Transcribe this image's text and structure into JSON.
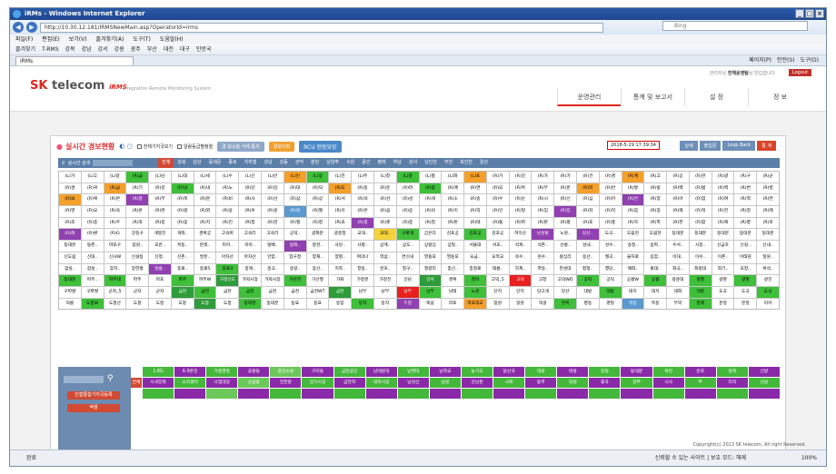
{
  "window": {
    "title": "iRMs - Windows Internet Explorer",
    "url": "http://10.30.12.181/IRMSNewMain.asp?OperatorId=irms",
    "search_placeholder": "Bing",
    "tab": "iRMs"
  },
  "menu": [
    "파일(F)",
    "편집(E)",
    "보기(V)",
    "즐겨찾기(A)",
    "도구(T)",
    "도움말(H)"
  ],
  "favorites": [
    "즐겨찾기",
    "T-RMS",
    "강북",
    "강남",
    "강서",
    "강원",
    "광주",
    "부산",
    "대전",
    "대구",
    "인방국"
  ],
  "ie_tools": [
    "페이지(P)",
    "안전(S)",
    "도구(O)"
  ],
  "site": {
    "logo_sk": "SK",
    "logo_tel": " telecom",
    "logo_irms": "iRMS",
    "tagline": "Integration Remote Monitoring System",
    "toplinks_prefix": "관리자님",
    "toplinks_admin": "전체운영팀",
    "toplinks_suffix": "님 반갑습니다",
    "logout": "Logout",
    "nav": [
      "운영관리",
      "통계 및 보고서",
      "설 정",
      "정 보"
    ]
  },
  "panel": {
    "title": "실시간 경보현황",
    "chk1": "전체기지국보기",
    "chk2": "일람등급별정렬",
    "pill1": "경 보소팅 삭제 통지",
    "pill2": "경보이력",
    "pill3": "RCU 현장요망",
    "timestamp": "2018-5-29 17:39:34",
    "btn_detail": "상세",
    "btn_out": "출입문",
    "btn_loop": "Loop Back",
    "btn_stats": "통 계",
    "search_label": "실시간 검색"
  },
  "regions": [
    "전체",
    "강북",
    "남산",
    "동대문",
    "종로",
    "지하철",
    "강남",
    "강동",
    "관악",
    "분당",
    "남양주",
    "수원",
    "용인",
    "평택",
    "하남",
    "강서",
    "남인천",
    "부천",
    "북인천",
    "일산"
  ],
  "grid_rows": [
    [
      [
        "(L)가",
        "w"
      ],
      [
        "(L)고",
        "w"
      ],
      [
        "(L)광",
        "w"
      ],
      [
        "(R)금",
        "g"
      ],
      [
        "(L)남",
        "w"
      ],
      [
        "(L)대",
        "w"
      ],
      [
        "(L)세",
        "w"
      ],
      [
        "(L)수",
        "w"
      ],
      [
        "(L)신",
        "w"
      ],
      [
        "(L)안",
        "w"
      ],
      [
        "(L)인",
        "o"
      ],
      [
        "(L)장",
        "g"
      ],
      [
        "(L)전",
        "w"
      ],
      [
        "(L)주",
        "w"
      ],
      [
        "(L)청",
        "w"
      ],
      [
        "(L)충",
        "g"
      ],
      [
        "(L)평",
        "w"
      ],
      [
        "(L)화",
        "w"
      ],
      [
        "(L)효",
        "o"
      ],
      [
        "(R)가",
        "w"
      ],
      [
        "(R)강",
        "w"
      ],
      [
        "(R)가",
        "w"
      ],
      [
        "(R)가",
        "w"
      ],
      [
        "(R)건",
        "w"
      ],
      [
        "(R)경",
        "w"
      ],
      [
        "(R)계",
        "o"
      ],
      [
        "(R)고",
        "w"
      ],
      [
        "(R)공",
        "w"
      ],
      [
        "(R)관",
        "w"
      ],
      [
        "(R)광",
        "w"
      ],
      [
        "(R)구",
        "w"
      ],
      [
        "(R)군",
        "w"
      ]
    ],
    [
      [
        "(R)권",
        "w"
      ],
      [
        "(R)귀",
        "w"
      ],
      [
        "(R)금",
        "o"
      ],
      [
        "(R)기",
        "w"
      ],
      [
        "(R)김",
        "w"
      ],
      [
        "(R)남",
        "g"
      ],
      [
        "(R)내",
        "w"
      ],
      [
        "(R)노",
        "w"
      ],
      [
        "(R)단",
        "w"
      ],
      [
        "(R)당",
        "w"
      ],
      [
        "(R)대",
        "w"
      ],
      [
        "(R)덕",
        "w"
      ],
      [
        "(R)도",
        "o"
      ],
      [
        "(R)동",
        "w"
      ],
      [
        "(R)둔",
        "w"
      ],
      [
        "(R)마",
        "w"
      ],
      [
        "(R)망",
        "g"
      ],
      [
        "(R)매",
        "w"
      ],
      [
        "(R)면",
        "w"
      ],
      [
        "(R)모",
        "w"
      ],
      [
        "(R)목",
        "w"
      ],
      [
        "(R)무",
        "w"
      ],
      [
        "(R)문",
        "w"
      ],
      [
        "(R)미",
        "o"
      ],
      [
        "(R)반",
        "w"
      ],
      [
        "(R)발",
        "w"
      ],
      [
        "(R)방",
        "w"
      ],
      [
        "(R)백",
        "w"
      ],
      [
        "(R)범",
        "w"
      ],
      [
        "(R)벽",
        "w"
      ],
      [
        "(R)변",
        "w"
      ],
      [
        "(R)병",
        "w"
      ]
    ],
    [
      [
        "(R)보",
        "o"
      ],
      [
        "(R)복",
        "w"
      ],
      [
        "(R)본",
        "w"
      ],
      [
        "(R)봉",
        "p"
      ],
      [
        "(R)부",
        "w"
      ],
      [
        "(R)북",
        "w"
      ],
      [
        "(R)분",
        "w"
      ],
      [
        "(R)비",
        "w"
      ],
      [
        "(R)사",
        "w"
      ],
      [
        "(R)산",
        "w"
      ],
      [
        "(R)삼",
        "w"
      ],
      [
        "(R)상",
        "w"
      ],
      [
        "(R)서",
        "w"
      ],
      [
        "(R)석",
        "w"
      ],
      [
        "(R)선",
        "w"
      ],
      [
        "(R)성",
        "w"
      ],
      [
        "(R)세",
        "w"
      ],
      [
        "(R)소",
        "w"
      ],
      [
        "(R)송",
        "w"
      ],
      [
        "(R)수",
        "w"
      ],
      [
        "(R)순",
        "w"
      ],
      [
        "(R)시",
        "w"
      ],
      [
        "(R)신",
        "w"
      ],
      [
        "(R)심",
        "w"
      ],
      [
        "(R)아",
        "w"
      ],
      [
        "(R)안",
        "p"
      ],
      [
        "(R)양",
        "w"
      ],
      [
        "(R)어",
        "w"
      ],
      [
        "(R)엄",
        "w"
      ],
      [
        "(R)여",
        "w"
      ],
      [
        "(R)역",
        "w"
      ],
      [
        "(R)연",
        "w"
      ]
    ],
    [
      [
        "(R)영",
        "w"
      ],
      [
        "(R)오",
        "w"
      ],
      [
        "(R)옥",
        "w"
      ],
      [
        "(R)온",
        "w"
      ],
      [
        "(R)완",
        "w"
      ],
      [
        "(R)왕",
        "w"
      ],
      [
        "(R)외",
        "w"
      ],
      [
        "(R)용",
        "w"
      ],
      [
        "(R)우",
        "w"
      ],
      [
        "(R)운",
        "w"
      ],
      [
        "(R)원",
        "b"
      ],
      [
        "(R)월",
        "w"
      ],
      [
        "(R)유",
        "w"
      ],
      [
        "(R)은",
        "w"
      ],
      [
        "(R)음",
        "w"
      ],
      [
        "(R)응",
        "w"
      ],
      [
        "(R)의",
        "w"
      ],
      [
        "(R)이",
        "w"
      ],
      [
        "(R)익",
        "w"
      ],
      [
        "(R)인",
        "w"
      ],
      [
        "(R)일",
        "w"
      ],
      [
        "(R)임",
        "w"
      ],
      [
        "(R)입",
        "p"
      ],
      [
        "(R)자",
        "w"
      ],
      [
        "(R)작",
        "w"
      ],
      [
        "(R)잠",
        "w"
      ],
      [
        "(R)장",
        "w"
      ],
      [
        "(R)재",
        "w"
      ],
      [
        "(R)적",
        "w"
      ],
      [
        "(R)전",
        "w"
      ],
      [
        "(R)정",
        "w"
      ],
      [
        "(R)제",
        "w"
      ]
    ],
    [
      [
        "(R)조",
        "w"
      ],
      [
        "(R)종",
        "w"
      ],
      [
        "(R)주",
        "w"
      ],
      [
        "(R)죽",
        "w"
      ],
      [
        "(R)중",
        "w"
      ],
      [
        "(R)증",
        "w"
      ],
      [
        "(R)지",
        "w"
      ],
      [
        "(R)진",
        "w"
      ],
      [
        "(R)창",
        "w"
      ],
      [
        "(R)천",
        "w"
      ],
      [
        "(R)철",
        "w"
      ],
      [
        "(R)청",
        "w"
      ],
      [
        "(R)초",
        "w"
      ],
      [
        "(R)총",
        "p"
      ],
      [
        "(R)춘",
        "w"
      ],
      [
        "(R)충",
        "w"
      ],
      [
        "(R)칠",
        "w"
      ],
      [
        "(R)탄",
        "w"
      ],
      [
        "(R)태",
        "w"
      ],
      [
        "(R)통",
        "w"
      ],
      [
        "(R)파",
        "w"
      ],
      [
        "(R)판",
        "w"
      ],
      [
        "(R)평",
        "w"
      ],
      [
        "(R)포",
        "w"
      ],
      [
        "(R)풍",
        "w"
      ],
      [
        "(R)하",
        "w"
      ],
      [
        "(R)학",
        "w"
      ],
      [
        "(R)한",
        "w"
      ],
      [
        "(R)함",
        "w"
      ],
      [
        "(R)해",
        "w"
      ],
      [
        "(R)향",
        "w"
      ],
      [
        "(R)호",
        "w"
      ]
    ],
    [
      [
        "(R)화",
        "p"
      ],
      [
        "(R)환",
        "w"
      ],
      [
        "(R)G",
        "w"
      ],
      [
        "강동구",
        "w"
      ],
      [
        "개봉진",
        "w"
      ],
      [
        "개화..",
        "w"
      ],
      [
        "경복궁",
        "w"
      ],
      [
        "고속버",
        "w"
      ],
      [
        "고속터",
        "w"
      ],
      [
        "고속터",
        "w"
      ],
      [
        "공덕..",
        "w"
      ],
      [
        "광화문",
        "w"
      ],
      [
        "광흥창",
        "w"
      ],
      [
        "교대..",
        "w"
      ],
      [
        "교대..",
        "y"
      ],
      [
        "구로개",
        "g"
      ],
      [
        "굽은다",
        "w"
      ],
      [
        "김포공",
        "w"
      ],
      [
        "김포공",
        "g"
      ],
      [
        "김포공",
        "w"
      ],
      [
        "까치산",
        "w"
      ],
      [
        "남성빌",
        "p"
      ],
      [
        "노원..",
        "w"
      ],
      [
        "당산..",
        "p"
      ],
      [
        "도곡..",
        "w"
      ],
      [
        "도림천",
        "w"
      ],
      [
        "도림천",
        "w"
      ],
      [
        "동대문",
        "w"
      ],
      [
        "동대문",
        "w"
      ],
      [
        "동대문",
        "w"
      ],
      [
        "동대문",
        "w"
      ],
      [
        "동대문",
        "w"
      ]
    ],
    [
      [
        "동대문",
        "w"
      ],
      [
        "등촌..",
        "w"
      ],
      [
        "마포구",
        "w"
      ],
      [
        "망원..",
        "w"
      ],
      [
        "모란..",
        "w"
      ],
      [
        "목동..",
        "w"
      ],
      [
        "문래..",
        "w"
      ],
      [
        "미아..",
        "w"
      ],
      [
        "미아..",
        "w"
      ],
      [
        "방배..",
        "w"
      ],
      [
        "방화..",
        "p"
      ],
      [
        "봉천..",
        "w"
      ],
      [
        "사당..",
        "w"
      ],
      [
        "사평..",
        "w"
      ],
      [
        "상계..",
        "w"
      ],
      [
        "상도..",
        "w"
      ],
      [
        "상왕십",
        "w"
      ],
      [
        "상일..",
        "w"
      ],
      [
        "서울대",
        "w"
      ],
      [
        "서초..",
        "w"
      ],
      [
        "석계..",
        "w"
      ],
      [
        "석촌..",
        "w"
      ],
      [
        "선릉..",
        "w"
      ],
      [
        "성내..",
        "w"
      ],
      [
        "성수..",
        "w"
      ],
      [
        "송정..",
        "w"
      ],
      [
        "송파..",
        "w"
      ],
      [
        "수서..",
        "w"
      ],
      [
        "시흥..",
        "w"
      ],
      [
        "신금호",
        "w"
      ],
      [
        "신길..",
        "w"
      ],
      [
        "신내..",
        "w"
      ]
    ],
    [
      [
        "신도림",
        "w"
      ],
      [
        "신대..",
        "w"
      ],
      [
        "신사W",
        "w"
      ],
      [
        "신설동",
        "w"
      ],
      [
        "신정..",
        "w"
      ],
      [
        "신촌..",
        "w"
      ],
      [
        "쌍문..",
        "w"
      ],
      [
        "아차산",
        "w"
      ],
      [
        "아차산",
        "w"
      ],
      [
        "안암..",
        "w"
      ],
      [
        "압구정",
        "w"
      ],
      [
        "양재..",
        "w"
      ],
      [
        "양평..",
        "w"
      ],
      [
        "여의나",
        "w"
      ],
      [
        "역삼..",
        "w"
      ],
      [
        "연신내",
        "w"
      ],
      [
        "영등포",
        "w"
      ],
      [
        "영등포",
        "w"
      ],
      [
        "오금..",
        "w"
      ],
      [
        "오목교",
        "w"
      ],
      [
        "옥수..",
        "w"
      ],
      [
        "온수..",
        "w"
      ],
      [
        "왕십리",
        "w"
      ],
      [
        "용산..",
        "w"
      ],
      [
        "월곡..",
        "w"
      ],
      [
        "을지로",
        "w"
      ],
      [
        "응암..",
        "w"
      ],
      [
        "이대..",
        "w"
      ],
      [
        "이수..",
        "w"
      ],
      [
        "이촌..",
        "w"
      ],
      [
        "이태원",
        "w"
      ],
      [
        "일원..",
        "w"
      ]
    ],
    [
      [
        "잠실..",
        "w"
      ],
      [
        "잠실..",
        "w"
      ],
      [
        "장지..",
        "w"
      ],
      [
        "장한평",
        "w"
      ],
      [
        "정릉..",
        "p"
      ],
      [
        "종로..",
        "w"
      ],
      [
        "종로5",
        "w"
      ],
      [
        "종로3",
        "g"
      ],
      [
        "중계..",
        "w"
      ],
      [
        "중곡..",
        "w"
      ],
      [
        "중랑..",
        "w"
      ],
      [
        "증산..",
        "w"
      ],
      [
        "지축..",
        "w"
      ],
      [
        "창동..",
        "w"
      ],
      [
        "천호..",
        "w"
      ],
      [
        "청구..",
        "w"
      ],
      [
        "청량리",
        "w"
      ],
      [
        "총신..",
        "w"
      ],
      [
        "충정로",
        "w"
      ],
      [
        "태릉..",
        "w"
      ],
      [
        "하계..",
        "w"
      ],
      [
        "학동..",
        "w"
      ],
      [
        "한성대",
        "w"
      ],
      [
        "합정..",
        "w"
      ],
      [
        "행당..",
        "w"
      ],
      [
        "혜화..",
        "w"
      ],
      [
        "홍대..",
        "w"
      ],
      [
        "화곡..",
        "w"
      ],
      [
        "화랑대",
        "w"
      ],
      [
        "회기..",
        "w"
      ],
      [
        "효창..",
        "w"
      ],
      [
        "흑석..",
        "w"
      ]
    ],
    [
      [
        "동대문",
        "g"
      ],
      [
        "파주..",
        "w"
      ],
      [
        "파주대",
        "g"
      ],
      [
        "파주",
        "w"
      ],
      [
        "마포",
        "w"
      ],
      [
        "파주",
        "g"
      ],
      [
        "파주W",
        "w"
      ],
      [
        "가정신도",
        "dg"
      ],
      [
        "가락시장",
        "w"
      ],
      [
        "가락시장",
        "w"
      ],
      [
        "가산전",
        "g"
      ],
      [
        "가산옆",
        "w"
      ],
      [
        "가좌",
        "w"
      ],
      [
        "가정문",
        "w"
      ],
      [
        "가정전",
        "w"
      ],
      [
        "강남",
        "w"
      ],
      [
        "강서",
        "dg"
      ],
      [
        "경복",
        "w"
      ],
      [
        "경의",
        "g"
      ],
      [
        "고덕_5",
        "w"
      ],
      [
        "고덕",
        "r"
      ],
      [
        "고창",
        "w"
      ],
      [
        "고덕WD",
        "w"
      ],
      [
        "공덕",
        "g"
      ],
      [
        "공덕",
        "w"
      ],
      [
        "공릉W",
        "w"
      ],
      [
        "공릉",
        "g"
      ],
      [
        "광운대",
        "w"
      ],
      [
        "광명",
        "g"
      ],
      [
        "광명",
        "w"
      ],
      [
        "광명",
        "g"
      ],
      [
        "광진",
        "w"
      ]
    ],
    [
      [
        "구파발",
        "w"
      ],
      [
        "구파발",
        "w"
      ],
      [
        "군자_5",
        "w"
      ],
      [
        "군자",
        "w"
      ],
      [
        "군자",
        "w"
      ],
      [
        "금천",
        "dg"
      ],
      [
        "금천",
        "g"
      ],
      [
        "금천",
        "w"
      ],
      [
        "금천",
        "g"
      ],
      [
        "금천",
        "w"
      ],
      [
        "금천",
        "w"
      ],
      [
        "금천WT",
        "w"
      ],
      [
        "금천",
        "dg"
      ],
      [
        "남부",
        "w"
      ],
      [
        "남부",
        "w"
      ],
      [
        "남부",
        "r"
      ],
      [
        "남부",
        "g"
      ],
      [
        "남태",
        "w"
      ],
      [
        "노원",
        "g"
      ],
      [
        "단지",
        "w"
      ],
      [
        "단지",
        "w"
      ],
      [
        "당고개",
        "w"
      ],
      [
        "당산",
        "w"
      ],
      [
        "대방",
        "w"
      ],
      [
        "대방",
        "g"
      ],
      [
        "대치",
        "w"
      ],
      [
        "대치",
        "w"
      ],
      [
        "대화",
        "w"
      ],
      [
        "대흥",
        "g"
      ],
      [
        "도곡",
        "w"
      ],
      [
        "도곡",
        "w"
      ],
      [
        "도곡",
        "g"
      ]
    ],
    [
      [
        "덕릉",
        "w"
      ],
      [
        "도봉W",
        "g"
      ],
      [
        "도봉산",
        "w"
      ],
      [
        "도봉",
        "w"
      ],
      [
        "도봉",
        "w"
      ],
      [
        "도봉",
        "w"
      ],
      [
        "도봉",
        "dg"
      ],
      [
        "도봉",
        "w"
      ],
      [
        "동대문",
        "g"
      ],
      [
        "동대문",
        "w"
      ],
      [
        "동묘",
        "w"
      ],
      [
        "동묘",
        "w"
      ],
      [
        "동암",
        "w"
      ],
      [
        "동작",
        "g"
      ],
      [
        "동작",
        "w"
      ],
      [
        "두정",
        "p"
      ],
      [
        "뚝섬",
        "w"
      ],
      [
        "마포",
        "w"
      ],
      [
        "마포대교",
        "o"
      ],
      [
        "망원",
        "w"
      ],
      [
        "망원",
        "w"
      ],
      [
        "먹골",
        "w"
      ],
      [
        "면목",
        "g"
      ],
      [
        "명동",
        "w"
      ],
      [
        "명일",
        "w"
      ],
      [
        "목동",
        "b"
      ],
      [
        "목동",
        "w"
      ],
      [
        "무악",
        "w"
      ],
      [
        "문래",
        "g"
      ],
      [
        "문정",
        "w"
      ],
      [
        "문정",
        "w"
      ],
      [
        "미아",
        "w"
      ]
    ]
  ],
  "lower": {
    "search_btn1": "인접통합기지국등록",
    "search_btn2": "엑셀",
    "header": [
      "",
      "1.8G",
      "6.9본전",
      "가평경찰",
      "공릉동",
      "광진소방",
      "구미동",
      "금천공단",
      "남대문대",
      "남영대",
      "남학교",
      "농기모",
      "당산국",
      "대방",
      "대흥",
      "망원",
      "동대문",
      "목련",
      "반포",
      "방화",
      "신방"
    ],
    "rows": [
      [
        "전체",
        "시내전화",
        "소리센터",
        "사업대장",
        "신공동",
        "전한문",
        "전기시장",
        "금천학",
        "대하시장",
        "남성산",
        "남원",
        "강남본",
        "사회",
        "동부",
        "대원",
        "중곡",
        "장부",
        "시사",
        "부",
        "리지",
        "신당"
      ],
      [
        "",
        "",
        "",
        "",
        "",
        "",
        "",
        "",
        "",
        "",
        "",
        "",
        "",
        "",
        "",
        "",
        "",
        "",
        "",
        "",
        ""
      ]
    ]
  },
  "copyright": "Copyright(c) 2013 SK telecom. All right Reserved.",
  "status": {
    "left": "완료",
    "zone": "신뢰할 수 있는 사이트 | 보호 모드: 해제",
    "zoom": "100%"
  }
}
